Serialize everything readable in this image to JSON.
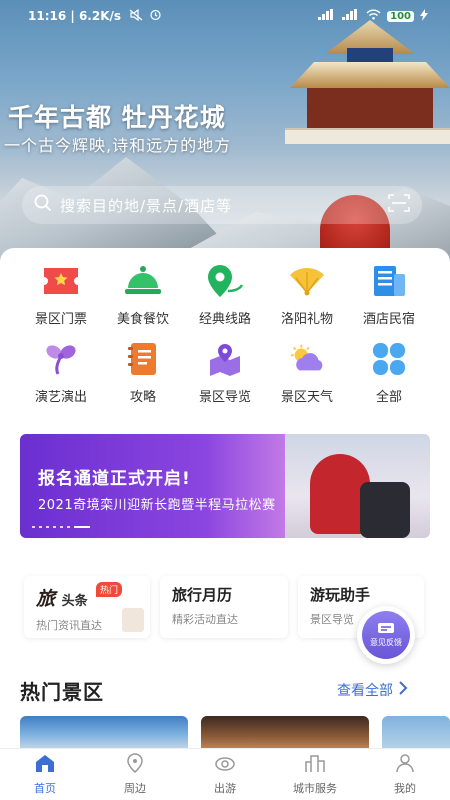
{
  "status_bar": {
    "time": "11:16",
    "speed": "6.2K/s",
    "battery": "100"
  },
  "hero": {
    "title": "千年古都 牡丹花城",
    "subtitle": "一个古今辉映,诗和远方的地方"
  },
  "search": {
    "placeholder": "搜索目的地/景点/酒店等"
  },
  "categories": [
    {
      "label": "景区门票",
      "icon": "ticket-icon"
    },
    {
      "label": "美食餐饮",
      "icon": "food-cloche-icon"
    },
    {
      "label": "经典线路",
      "icon": "route-pin-icon"
    },
    {
      "label": "洛阳礼物",
      "icon": "fan-gift-icon"
    },
    {
      "label": "酒店民宿",
      "icon": "hotel-icon"
    },
    {
      "label": "演艺演出",
      "icon": "performance-icon"
    },
    {
      "label": "攻略",
      "icon": "guide-book-icon"
    },
    {
      "label": "景区导览",
      "icon": "map-guide-icon"
    },
    {
      "label": "景区天气",
      "icon": "weather-icon"
    },
    {
      "label": "全部",
      "icon": "all-grid-icon"
    }
  ],
  "banner": {
    "headline": "报名通道正式开启!",
    "caption": "2021奇境栾川迎新长跑暨半程马拉松赛"
  },
  "features": {
    "news": {
      "logo_main": "旅",
      "logo_sub": "头条",
      "badge": "热门",
      "subtitle": "热门资讯直达"
    },
    "calendar": {
      "title": "旅行月历",
      "subtitle": "精彩活动直达"
    },
    "assistant": {
      "title": "游玩助手",
      "subtitle": "景区导览"
    }
  },
  "feedback": {
    "label": "意见反馈"
  },
  "hot_spots": {
    "title": "热门景区",
    "see_all": "查看全部"
  },
  "tabbar": [
    {
      "label": "首页",
      "icon": "home-icon",
      "active": true
    },
    {
      "label": "周边",
      "icon": "location-icon",
      "active": false
    },
    {
      "label": "出游",
      "icon": "travel-icon",
      "active": false
    },
    {
      "label": "城市服务",
      "icon": "city-icon",
      "active": false
    },
    {
      "label": "我的",
      "icon": "profile-icon",
      "active": false
    }
  ],
  "colors": {
    "accent": "#3d6fd3",
    "hot_badge": "#ee4b3b",
    "banner_purple": "#6b2fd0"
  }
}
